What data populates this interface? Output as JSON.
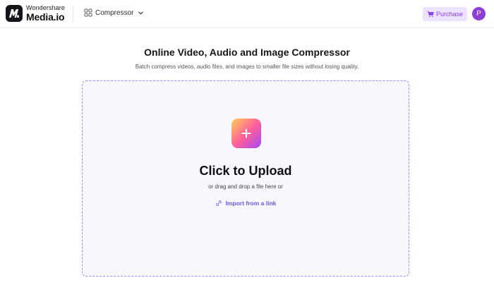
{
  "header": {
    "brand_top": "Wondershare",
    "brand_bottom": "Media.io",
    "tool_selector_label": "Compressor",
    "purchase_label": "Purchase",
    "avatar_initial": "P"
  },
  "main": {
    "title": "Online Video, Audio and Image Compressor",
    "subtitle": "Batch compress videos, audio files, and images to smaller file sizes without losing quality."
  },
  "upload": {
    "heading": "Click to Upload",
    "hint": "or drag and drop a file here or",
    "import_link": "Import from a link"
  },
  "colors": {
    "accent": "#6e56e8",
    "purchase_bg": "#efe2ff",
    "purchase_text": "#8b3ff2",
    "avatar": "#8d3ed6",
    "dropzone_border": "#9d8cf2",
    "dropzone_bg": "#f8f7fe"
  },
  "icons": {
    "logo": "media-io-logo-icon",
    "tool_selector": "grid-icon",
    "dropdown": "chevron-down-icon",
    "purchase": "cart-icon",
    "upload": "plus-icon",
    "import": "link-icon"
  }
}
